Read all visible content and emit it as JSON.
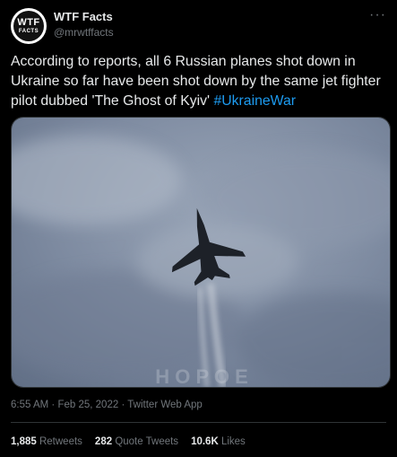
{
  "author": {
    "display_name": "WTF Facts",
    "handle": "@mrwtffacts",
    "avatar_text_top": "WTF",
    "avatar_text_bottom": "FACTS"
  },
  "tweet": {
    "text": "According to reports, all 6 Russian planes shot down in Ukraine so far have been shot down by the same jet fighter pilot dubbed 'The Ghost of Kyiv' ",
    "hashtag": "#UkraineWar"
  },
  "media": {
    "watermark": "H O P O E"
  },
  "meta": {
    "time": "6:55 AM",
    "date": "Feb 25, 2022",
    "source": "Twitter Web App",
    "separator": "·"
  },
  "stats": {
    "retweets": {
      "count": "1,885",
      "label": "Retweets"
    },
    "quotes": {
      "count": "282",
      "label": "Quote Tweets"
    },
    "likes": {
      "count": "10.6K",
      "label": "Likes"
    }
  },
  "icons": {
    "more": "more-options-icon"
  },
  "colors": {
    "background": "#000000",
    "text": "#e7e9ea",
    "secondary": "#71767b",
    "link": "#1d9bf0",
    "border": "#2f3336"
  }
}
